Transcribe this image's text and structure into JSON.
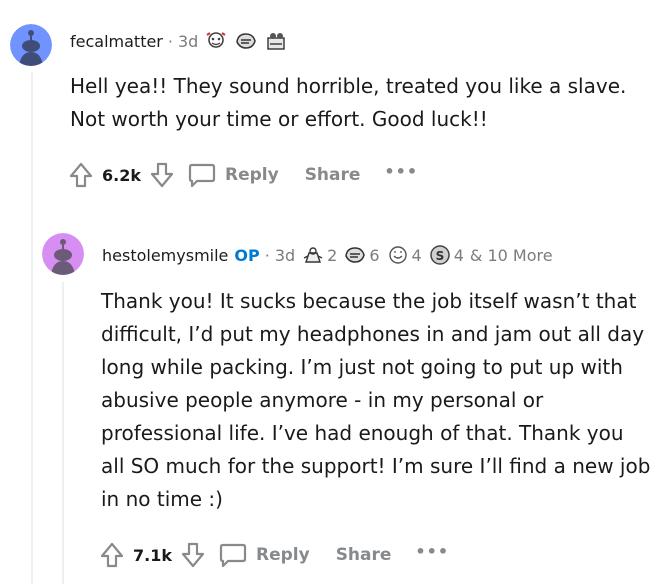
{
  "comments": [
    {
      "username": "fecalmatter",
      "separator": "·",
      "time": "3d",
      "avatar_color": "#7193ff",
      "awards": [
        {
          "icon": "helpful-award-icon",
          "count": ""
        },
        {
          "icon": "wholesome-award-icon",
          "count": ""
        },
        {
          "icon": "bravo-award-icon",
          "count": ""
        }
      ],
      "body": "Hell yea!! They sound horrible, treated you like a slave. Not worth your time or effort. Good luck!!",
      "votes": "6.2k",
      "reply_label": "Reply",
      "share_label": "Share",
      "more_label": "•••"
    },
    {
      "username": "hestolemysmile",
      "op_badge": "OP",
      "separator": "·",
      "time": "3d",
      "avatar_color": "#d68ef2",
      "awards": [
        {
          "icon": "rocket-like-award-icon",
          "count": "2"
        },
        {
          "icon": "wholesome-award-icon",
          "count": "6"
        },
        {
          "icon": "face-award-icon",
          "count": "4"
        },
        {
          "icon": "silver-award-icon",
          "count": "4"
        }
      ],
      "more_awards": "& 10 More",
      "body": "Thank you! It sucks because the job itself wasn’t that difficult, I’d put my headphones in and jam out all day long while packing. I’m just not going to put up with abusive people anymore - in my personal or professional life. I’ve had enough of that. Thank you all SO much for the support! I’m sure I’ll find a new job in no time :)",
      "votes": "7.1k",
      "reply_label": "Reply",
      "share_label": "Share",
      "more_label": "•••"
    }
  ],
  "colors": {
    "op": "#0079d3",
    "muted": "#878a8c",
    "text": "#1a1a1b",
    "thread_line": "#edeff1"
  }
}
